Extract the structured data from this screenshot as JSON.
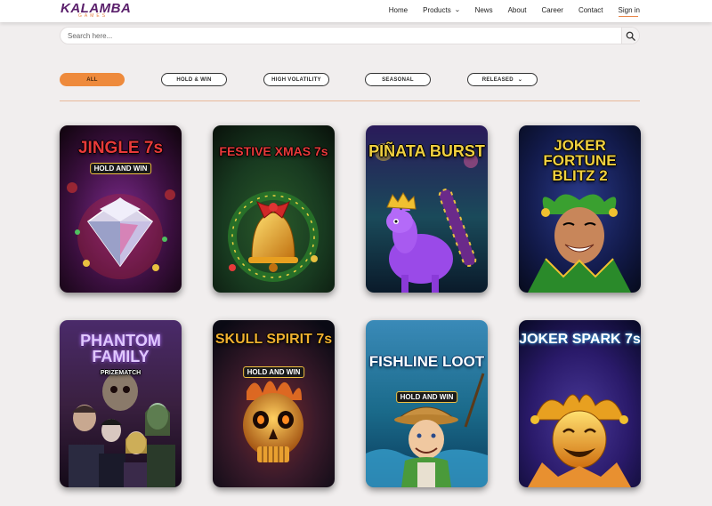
{
  "brand": {
    "name": "KALAMBA",
    "tagline": "GAMES"
  },
  "nav": {
    "items": [
      {
        "label": "Home"
      },
      {
        "label": "Products",
        "has_dropdown": true
      },
      {
        "label": "News"
      },
      {
        "label": "About"
      },
      {
        "label": "Career"
      },
      {
        "label": "Contact"
      },
      {
        "label": "Sign in"
      }
    ]
  },
  "search": {
    "placeholder": "Search here...",
    "value": ""
  },
  "filters": [
    {
      "label": "ALL",
      "active": true
    },
    {
      "label": "HOLD & WIN",
      "active": false
    },
    {
      "label": "HIGH VOLATILITY",
      "active": false
    },
    {
      "label": "SEASONAL",
      "active": false
    },
    {
      "label": "RELEASED",
      "active": false,
      "has_dropdown": true
    }
  ],
  "games": [
    {
      "title": "JINGLE 7s",
      "subtitle": "HOLD AND WIN",
      "theme": "jingle"
    },
    {
      "title": "FESTIVE XMAS 7s",
      "subtitle": "",
      "theme": "festive"
    },
    {
      "title": "PIÑATA BURST",
      "subtitle": "",
      "theme": "pinata"
    },
    {
      "title": "JOKER FORTUNE BLITZ 2",
      "subtitle": "",
      "theme": "joker-blitz"
    },
    {
      "title": "PHANTOM FAMILY",
      "subtitle": "PRIZEMATCH",
      "theme": "phantom"
    },
    {
      "title": "SKULL SPIRIT 7s",
      "subtitle": "HOLD AND WIN",
      "theme": "skull"
    },
    {
      "title": "FISHLINE LOOT",
      "subtitle": "HOLD AND WIN",
      "theme": "fishline"
    },
    {
      "title": "JOKER SPARK 7s",
      "subtitle": "",
      "theme": "joker-spark"
    }
  ],
  "colors": {
    "accent": "#ee8a3c",
    "brand": "#5a1f6b",
    "background": "#f1eeee"
  },
  "icons": {
    "search": "magnifier-icon",
    "dropdown": "chevron-down-icon"
  }
}
